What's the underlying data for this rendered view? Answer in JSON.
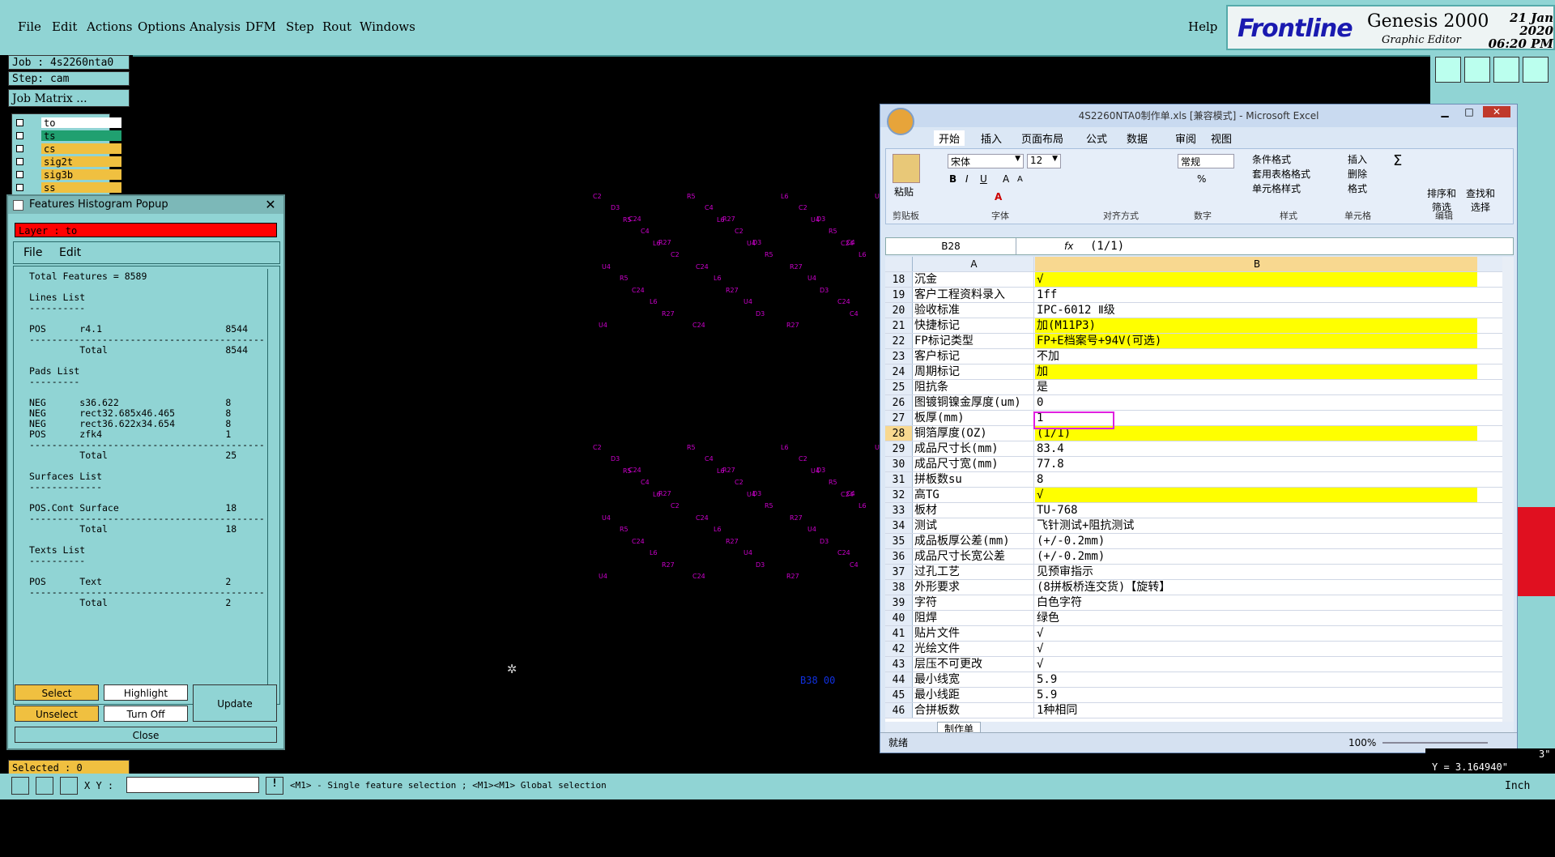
{
  "genesis": {
    "menu": [
      "File",
      "Edit",
      "Actions",
      "Options",
      "Analysis",
      "DFM",
      "Step",
      "Rout",
      "Windows"
    ],
    "help": "Help",
    "brand": {
      "logo": "Frontline",
      "product": "Genesis 2000",
      "subtitle": "Graphic Editor",
      "date": "21 Jan 2020",
      "time": "06:20 PM"
    },
    "job": "Job : 4s2260nta0",
    "step": "Step: cam",
    "job_matrix": "Job Matrix ...",
    "layers": [
      {
        "name": "to",
        "color": "#ffffff"
      },
      {
        "name": "ts",
        "color": "#20a070"
      },
      {
        "name": "cs",
        "color": "#f0c040"
      },
      {
        "name": "sig2t",
        "color": "#f0c040"
      },
      {
        "name": "sig3b",
        "color": "#f0c040"
      },
      {
        "name": "ss",
        "color": "#f0c040"
      }
    ],
    "selected": "Selected : 0",
    "xy_label": "X Y :",
    "hint": "<M1> - Single feature selection ; <M1><M1> Global selection",
    "units": "Inch",
    "coord_x": "3\"",
    "coord_y": "Y = 3.164940\"",
    "canvas_readout": "B38 00"
  },
  "histogram": {
    "title": "Features Histogram Popup",
    "layer": "Layer :  to",
    "menu": [
      "File",
      "Edit"
    ],
    "lines": [
      "Total Features = 8589",
      "",
      "Lines List",
      "----------",
      "",
      "POS      r4.1                      8544",
      "------------------------------------------",
      "         Total                     8544",
      "",
      "Pads List",
      "---------",
      "",
      "NEG      s36.622                   8",
      "NEG      rect32.685x46.465         8",
      "NEG      rect36.622x34.654         8",
      "POS      zfk4                      1",
      "------------------------------------------",
      "         Total                     25",
      "",
      "Surfaces List",
      "-------------",
      "",
      "POS.Cont Surface                   18",
      "------------------------------------------",
      "         Total                     18",
      "",
      "Texts List",
      "----------",
      "",
      "POS      Text                      2",
      "------------------------------------------",
      "         Total                     2"
    ],
    "buttons": {
      "select": "Select",
      "highlight": "Highlight",
      "update": "Update",
      "unselect": "Unselect",
      "turn_off": "Turn Off",
      "close": "Close"
    }
  },
  "excel": {
    "title": "4S2260NTA0制作单.xls  [兼容模式] - Microsoft Excel",
    "tabs": [
      "开始",
      "插入",
      "页面布局",
      "公式",
      "数据",
      "审阅",
      "视图"
    ],
    "font_name": "宋体",
    "font_size": "12",
    "number_format": "常规",
    "groups": [
      "剪贴板",
      "字体",
      "对齐方式",
      "数字",
      "样式",
      "单元格",
      "编辑"
    ],
    "style_items": [
      "条件格式",
      "套用表格格式",
      "单元格样式"
    ],
    "cell_items": [
      "插入",
      "删除",
      "格式"
    ],
    "edit_items": [
      "排序和筛选",
      "查找和选择"
    ],
    "paste": "粘贴",
    "name_box": "B28",
    "formula": "(1/1)",
    "col_a": "A",
    "col_b": "B",
    "rows": [
      {
        "n": "18",
        "a": "沉金",
        "b": "√",
        "y": true
      },
      {
        "n": "19",
        "a": "客户工程资料录入",
        "b": "1ff",
        "y": false
      },
      {
        "n": "20",
        "a": "验收标准",
        "b": "IPC-6012 Ⅱ级",
        "y": false
      },
      {
        "n": "21",
        "a": "快捷标记",
        "b": "加(M11P3)",
        "y": true
      },
      {
        "n": "22",
        "a": "FP标记类型",
        "b": "FP+E档案号+94V(可选)",
        "y": true
      },
      {
        "n": "23",
        "a": "客户标记",
        "b": "不加",
        "y": false
      },
      {
        "n": "24",
        "a": "周期标记",
        "b": "加",
        "y": true
      },
      {
        "n": "25",
        "a": "阻抗条",
        "b": "是",
        "y": false
      },
      {
        "n": "26",
        "a": "图镀铜镍金厚度(um)",
        "b": "0",
        "y": false
      },
      {
        "n": "27",
        "a": "板厚(mm)",
        "b": "1",
        "y": false
      },
      {
        "n": "28",
        "a": "铜箔厚度(OZ)",
        "b": " (1/1)",
        "y": true
      },
      {
        "n": "29",
        "a": "成品尺寸长(mm)",
        "b": "83.4",
        "y": false
      },
      {
        "n": "30",
        "a": "成品尺寸宽(mm)",
        "b": "77.8",
        "y": false
      },
      {
        "n": "31",
        "a": "拼板数su",
        "b": "8",
        "y": false
      },
      {
        "n": "32",
        "a": "高TG",
        "b": "√",
        "y": true
      },
      {
        "n": "33",
        "a": "板材",
        "b": "TU-768",
        "y": false
      },
      {
        "n": "34",
        "a": "测试",
        "b": "飞针测试+阻抗测试",
        "y": false
      },
      {
        "n": "35",
        "a": "成品板厚公差(mm)",
        "b": "(+/-0.2mm)",
        "y": false
      },
      {
        "n": "36",
        "a": "成品尺寸长宽公差",
        "b": "(+/-0.2mm)",
        "y": false
      },
      {
        "n": "37",
        "a": "过孔工艺",
        "b": "见预审指示",
        "y": false
      },
      {
        "n": "38",
        "a": "外形要求",
        "b": "(8拼板桥连交货)【旋转】",
        "y": false
      },
      {
        "n": "39",
        "a": "字符",
        "b": "白色字符",
        "y": false
      },
      {
        "n": "40",
        "a": "阻焊",
        "b": "绿色",
        "y": false
      },
      {
        "n": "41",
        "a": "贴片文件",
        "b": "√",
        "y": false
      },
      {
        "n": "42",
        "a": "光绘文件",
        "b": "√",
        "y": false
      },
      {
        "n": "43",
        "a": "层压不可更改",
        "b": "√",
        "y": false
      },
      {
        "n": "44",
        "a": "最小线宽",
        "b": "5.9",
        "y": false
      },
      {
        "n": "45",
        "a": "最小线距",
        "b": "5.9",
        "y": false
      },
      {
        "n": "46",
        "a": "合拼板数",
        "b": "1种相同",
        "y": false
      }
    ],
    "sheet_tab": "制作单",
    "status": "就绪",
    "zoom": "100%"
  }
}
